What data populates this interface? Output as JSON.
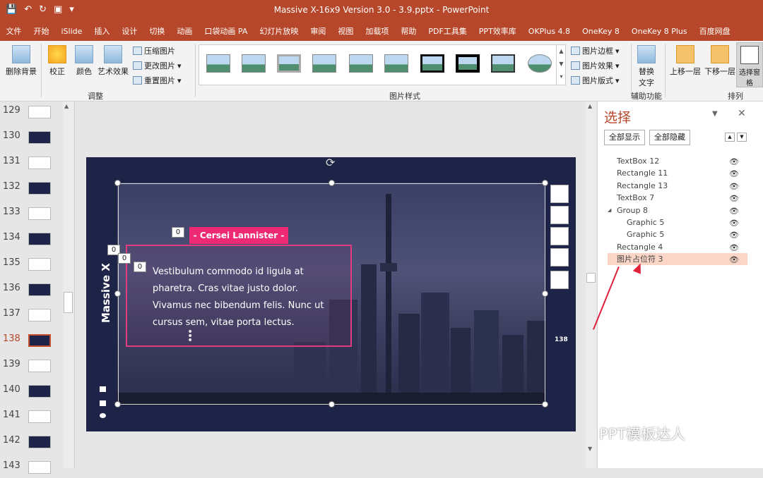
{
  "window": {
    "title": "Massive X-16x9 Version 3.0 - 3.9.pptx  -  PowerPoint"
  },
  "menu": [
    "文件",
    "开始",
    "iSlide",
    "插入",
    "设计",
    "切换",
    "动画",
    "口袋动画 PA",
    "幻灯片放映",
    "审阅",
    "视图",
    "加载项",
    "帮助",
    "PDF工具集",
    "PPT效率库",
    "OKPlus 4.8",
    "OneKey 8",
    "OneKey 8 Plus",
    "百度网盘"
  ],
  "ribbon": {
    "remove_bg": "删除背景",
    "correct": "校正",
    "color": "颜色",
    "art_effect": "艺术效果",
    "compress": "压缩图片",
    "change": "更改图片",
    "reset": "重置图片",
    "group_adjust": "调整",
    "group_styles": "图片样式",
    "border": "图片边框",
    "effect": "图片效果",
    "layout": "图片版式",
    "alt_text_1": "替换",
    "alt_text_2": "文字",
    "group_access": "辅助功能",
    "bring_forward": "上移一层",
    "send_backward": "下移一层",
    "selection_pane": "选择窗格",
    "group_arrange": "排列"
  },
  "thumbnails": [
    {
      "num": "129",
      "dark": false
    },
    {
      "num": "130",
      "dark": true
    },
    {
      "num": "131",
      "dark": false
    },
    {
      "num": "132",
      "dark": true
    },
    {
      "num": "133",
      "dark": false
    },
    {
      "num": "134",
      "dark": true
    },
    {
      "num": "135",
      "dark": false
    },
    {
      "num": "136",
      "dark": true
    },
    {
      "num": "137",
      "dark": false
    },
    {
      "num": "138",
      "dark": true,
      "active": true
    },
    {
      "num": "139",
      "dark": false
    },
    {
      "num": "140",
      "dark": true
    },
    {
      "num": "141",
      "dark": false
    },
    {
      "num": "142",
      "dark": true
    },
    {
      "num": "143",
      "dark": false
    }
  ],
  "slide": {
    "tag": "- Cersei Lannister -",
    "body": "Vestibulum commodo id ligula at pharetra. Cras vitae justo dolor. Vivamus nec bibendum felis. Nunc ut cursus sem, vitae porta lectus.",
    "vertical_title": "Massive X",
    "page_number": "138",
    "zero_label": "0"
  },
  "selection_pane": {
    "title": "选择",
    "show_all": "全部显示",
    "hide_all": "全部隐藏",
    "layers": [
      {
        "name": "TextBox 12",
        "indent": 0
      },
      {
        "name": "Rectangle 11",
        "indent": 0
      },
      {
        "name": "Rectangle 13",
        "indent": 0
      },
      {
        "name": "TextBox 7",
        "indent": 0
      },
      {
        "name": "Group 8",
        "indent": 0,
        "group": true
      },
      {
        "name": "Graphic 5",
        "indent": 1
      },
      {
        "name": "Graphic 5",
        "indent": 1
      },
      {
        "name": "Rectangle 4",
        "indent": 0
      },
      {
        "name": "图片占位符 3",
        "indent": 0,
        "selected": true
      }
    ]
  },
  "watermark": "PPT模板达人",
  "colors": {
    "accent": "#b7472a",
    "slide_bg": "#1e2348",
    "pink": "#ee2a74",
    "arrow": "#e0213b"
  }
}
